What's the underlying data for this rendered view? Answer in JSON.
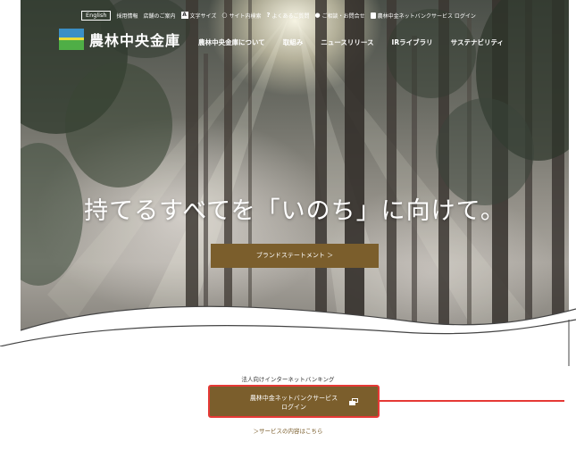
{
  "header": {
    "utility": {
      "english": "English",
      "recruit": "採用情報",
      "branches": "店舗のご案内",
      "text_size_icon": "A",
      "text_size": "文字サイズ",
      "site_search": "サイト内検索",
      "faq_icon": "?",
      "faq": "よくあるご質問",
      "contact": "ご相談・お問合せ",
      "netbank_login": "農林中金ネットバンクサービス ログイン"
    },
    "logo_text": "農林中央金庫",
    "nav": [
      "農林中央金庫について",
      "取組み",
      "ニュースリリース",
      "IRライブラリ",
      "サステナビリティ"
    ]
  },
  "hero": {
    "headline": "持てるすべてを「いのち」に向けて。",
    "brand_button": "ブランドステートメント ＞"
  },
  "service": {
    "label": "法人向けインターネットバンキング",
    "button_line1": "農林中金ネットバンクサービス",
    "button_line2": "ログイン",
    "link": "＞サービスの内容はこちら"
  },
  "colors": {
    "brand_brown": "#7b5e2c",
    "highlight_red": "#e53935",
    "logo_blue": "#3b8fc6",
    "logo_green": "#4fae46",
    "logo_yellow": "#e8dc3a"
  },
  "icons": [
    "search-icon",
    "person-icon",
    "lock-icon",
    "external-window-icon"
  ]
}
